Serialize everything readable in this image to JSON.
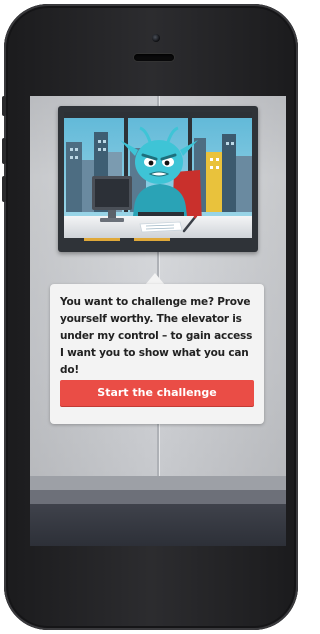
{
  "dialog": {
    "message": "You want to challenge me? Prove yourself worthy. The elevator is under my control – to gain access I want you to show what you can do!",
    "button_label": "Start the challenge"
  },
  "colors": {
    "accent": "#ea4d46",
    "dialog_bg": "#f3f3f3",
    "character_skin": "#3ec4d6",
    "sky": "#6fc4df"
  },
  "icons": {
    "character": "blue-alien-character",
    "monitor": "computer-monitor-icon",
    "pen": "pen-icon"
  }
}
